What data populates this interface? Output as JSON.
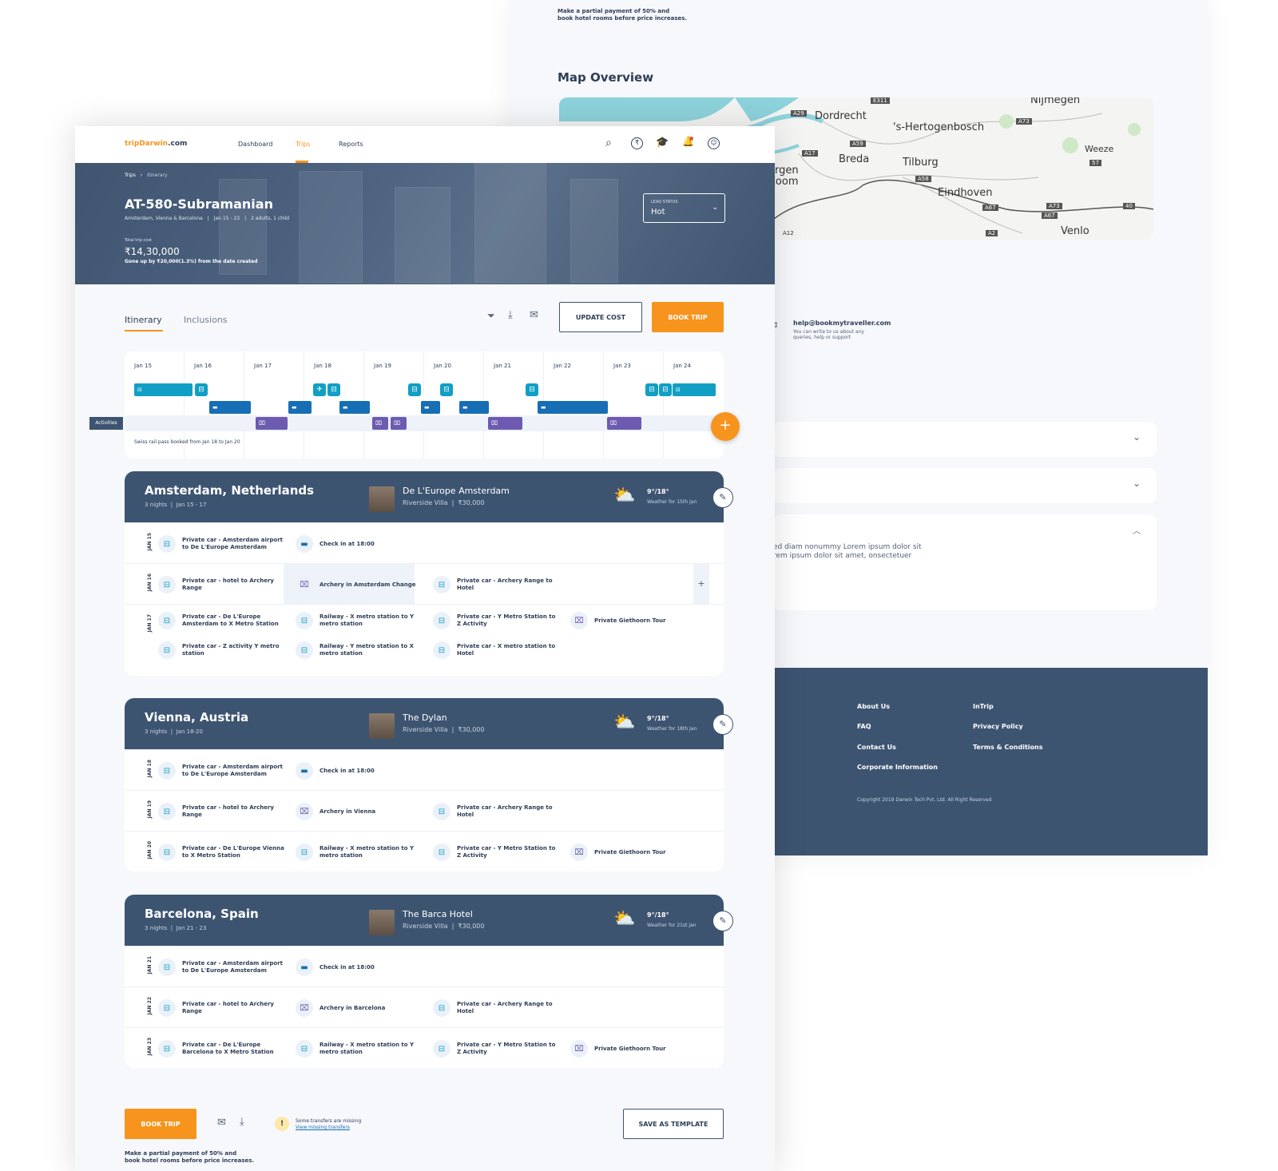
{
  "bg": {
    "payment_note_1": "Make a partial payment of 50% and",
    "payment_note_2": "book hotel rooms before price increases.",
    "map_title": "Map Overview",
    "map_labels": [
      "Dordrecht",
      "'s-Hertogenbosch",
      "Breda",
      "Tilburg",
      "Eindhoven",
      "Weeze",
      "Venlo",
      "ergen",
      "Zoom",
      "Nijmegen"
    ],
    "road_labels": [
      "E311",
      "A29",
      "A73",
      "A59",
      "A17",
      "A58",
      "57",
      "A67",
      "A73",
      "A67",
      "40",
      "A12",
      "A2"
    ],
    "help_email": "help@bookmytraveller.com",
    "help_sub_1": "You can write to us about any",
    "help_sub_2": "queries, help or support",
    "faq_text_1": "ed diam nonummy Lorem ipsum dolor sit",
    "faq_text_2": "rem ipsum dolor sit amet, onsectetuer",
    "footer": {
      "col1": [
        "About Us",
        "FAQ",
        "Contact Us",
        "Corporate Information"
      ],
      "col2": [
        "InTrip",
        "Privacy Policy",
        "Terms & Conditions"
      ],
      "copyright": "Copyright 2019 Darwin Tech Pvt. Ltd. All Right Reserved"
    }
  },
  "nav": {
    "logo_a": "tripDarwin",
    "logo_b": ".com",
    "links": [
      "Dashboard",
      "Trips",
      "Reports"
    ],
    "active": "Trips"
  },
  "hero": {
    "breadcrumb": [
      "Trips",
      "Itinerary"
    ],
    "title": "AT-580-Subramanian",
    "meta": [
      "Amsterdam, Vienna & Barcelona",
      "Jan 15 - 23",
      "2 adults, 1 child"
    ],
    "cost_label": "Total trip cost",
    "cost": "₹14,30,000",
    "cost_note": "Gone up by ₹20,000(1.3%) from the date created",
    "lead_label": "LEAD STATUS",
    "lead_value": "Hot"
  },
  "tabs": [
    "Itinerary",
    "Inclusions"
  ],
  "actions": {
    "update": "UPDATE COST",
    "book": "BOOK TRIP"
  },
  "timeline": {
    "days": [
      "Jan 15",
      "Jan 16",
      "Jan 17",
      "Jan 18",
      "Jan 19",
      "Jan 20",
      "Jan 21",
      "Jan 22",
      "Jan 23",
      "Jan 24"
    ],
    "activities_label": "Activities",
    "note": "Swiss rail pass booked from Jan 18 to Jan 20"
  },
  "cities": [
    {
      "name": "Amsterdam, Netherlands",
      "nights": "3 nights",
      "dates": "Jan 15 - 17",
      "hotel": "De L'Europe Amsterdam",
      "room": "Riverside Villa",
      "price": "₹30,000",
      "temp": "9°/18°",
      "weather_for": "Weather for 15th Jan",
      "rows": [
        {
          "date": "JAN 15",
          "items": [
            [
              "t",
              "Private car - Amsterdam airport to De L'Europe Amsterdam"
            ],
            [
              "b",
              "Check in at 18:00"
            ]
          ]
        },
        {
          "date": "JAN 16",
          "items": [
            [
              "t",
              "Private car - hotel to Archery Range"
            ],
            [
              "p",
              "Archery in Amsterdam Change"
            ],
            [
              "t",
              "Private car - Archery Range to Hotel"
            ]
          ]
        },
        {
          "date": "JAN 17",
          "items": [
            [
              "t",
              "Private car - De L'Europe Amsterdam to X Metro Station"
            ],
            [
              "t",
              "Railway - X metro station to Y metro station"
            ],
            [
              "t",
              "Private car - Y Metro Station to Z Activity"
            ],
            [
              "p",
              "Private Giethoorn Tour"
            ]
          ]
        },
        {
          "date": "",
          "items": [
            [
              "t",
              "Private car - Z activity Y metro station"
            ],
            [
              "t",
              "Railway - Y metro station to X metro station"
            ],
            [
              "t",
              "Private car - X metro station to Hotel"
            ]
          ]
        }
      ]
    },
    {
      "name": "Vienna, Austria",
      "nights": "3 nights",
      "dates": "Jan 18-20",
      "hotel": "The Dylan",
      "room": "Riverside Villa",
      "price": "₹30,000",
      "temp": "9°/18°",
      "weather_for": "Weather for 18th Jan",
      "rows": [
        {
          "date": "JAN 18",
          "items": [
            [
              "t",
              "Private car - Amsterdam airport to De L'Europe Amsterdam"
            ],
            [
              "b",
              "Check in at 18:00"
            ]
          ]
        },
        {
          "date": "JAN 19",
          "items": [
            [
              "t",
              "Private car - hotel to Archery Range"
            ],
            [
              "p",
              "Archery in Vienna"
            ],
            [
              "t",
              "Private car - Archery Range to Hotel"
            ]
          ]
        },
        {
          "date": "JAN 20",
          "items": [
            [
              "t",
              "Private car - De L'Europe Vienna to X Metro Station"
            ],
            [
              "t",
              "Railway - X metro station to Y metro station"
            ],
            [
              "t",
              "Private car - Y Metro Station to Z Activity"
            ],
            [
              "p",
              "Private Giethoorn Tour"
            ]
          ]
        }
      ]
    },
    {
      "name": "Barcelona, Spain",
      "nights": "3 nights",
      "dates": "Jan 21 - 23",
      "hotel": "The Barca Hotel",
      "room": "Riverside Villa",
      "price": "₹30,000",
      "temp": "9°/18°",
      "weather_for": "Weather for 21st Jan",
      "rows": [
        {
          "date": "JAN 21",
          "items": [
            [
              "t",
              "Private car - Amsterdam airport to De L'Europe Amsterdam"
            ],
            [
              "b",
              "Check in at 18:00"
            ]
          ]
        },
        {
          "date": "JAN 22",
          "items": [
            [
              "t",
              "Private car - hotel to Archery Range"
            ],
            [
              "p",
              "Archery in Barcelona"
            ],
            [
              "t",
              "Private car - Archery Range to Hotel"
            ]
          ]
        },
        {
          "date": "JAN 23",
          "items": [
            [
              "t",
              "Private car - De L'Europe Barcelona to X Metro Station"
            ],
            [
              "t",
              "Railway - X metro station to Y metro station"
            ],
            [
              "t",
              "Private car - Y Metro Station to Z Activity"
            ],
            [
              "p",
              "Private Giethoorn Tour"
            ]
          ]
        }
      ]
    }
  ],
  "bottom": {
    "book": "BOOK TRIP",
    "warn_1": "Some transfers are missing",
    "warn_2": "View missing transfers",
    "save": "SAVE AS TEMPLATE",
    "note_1": "Make a partial payment of 50% and",
    "note_2": "book hotel rooms before price increases."
  },
  "colors": {
    "accent": "#f7941d",
    "navy": "#3d5471",
    "teal": "#119fc4",
    "blue": "#166eb5",
    "purple": "#6c5bb0"
  }
}
